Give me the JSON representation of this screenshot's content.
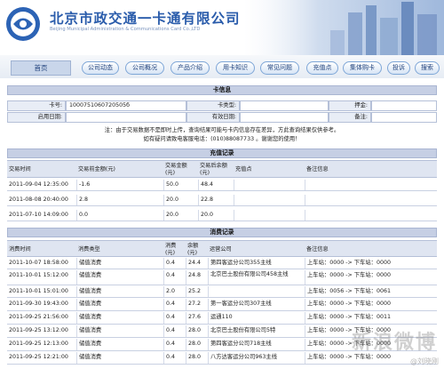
{
  "header": {
    "title_cn": "北京市政交通一卡通有限公司",
    "title_en": "Beijing Municipal Administration & Communications Card Co.,LTD"
  },
  "nav": {
    "home": "首页",
    "items": [
      "公司动态",
      "公司概况",
      "产品介绍",
      "用卡知识",
      "常见问题",
      "充值点",
      "集体购卡",
      "投诉",
      "搜索"
    ]
  },
  "card_info": {
    "title": "卡信息",
    "card_no_label": "卡号:",
    "card_no_value": "1000751060720505б",
    "card_type_label": "卡类型:",
    "card_type_value": "",
    "deposit_label": "押金:",
    "deposit_value": "",
    "enable_date_label": "启用日期:",
    "enable_date_value": "",
    "valid_date_label": "有效日期:",
    "valid_date_value": "",
    "remark_label": "备注:",
    "remark_value": "",
    "note_line1": "注：由于交易数据不是即时上传，查询结果可能与卡内信息存在差异，方此查询结果仅供参考。",
    "note_line2": "如有疑问请致电客服电话：(010)88087733 。谢谢您的使用！"
  },
  "recharge": {
    "title": "充值记录",
    "headers": [
      "交易时间",
      "交易前金额(元)",
      "交易金额(元)",
      "交易后余额(元)",
      "充值点",
      "备注信息"
    ],
    "rows": [
      [
        "2011-09-04 12:35:00",
        "-1.6",
        "50.0",
        "48.4",
        "",
        ""
      ],
      [
        "2011-08-08 20:40:00",
        "2.8",
        "20.0",
        "22.8",
        "",
        ""
      ],
      [
        "2011-07-10 14:09:00",
        "0.0",
        "20.0",
        "20.0",
        "",
        ""
      ]
    ]
  },
  "consume": {
    "title": "消费记录",
    "headers": [
      "消费时间",
      "消费类型",
      "消费(元)",
      "余额(元)",
      "运营公司",
      "备注信息"
    ],
    "rows": [
      [
        "2011-10-07 18:58:00",
        "储值消费",
        "0.4",
        "24.4",
        "第四客运分公司355主线",
        "上车站：0000 -> 下车站：0000"
      ],
      [
        "2011-10-01 15:12:00",
        "储值消费",
        "0.4",
        "24.8",
        "北京巴士股份有限公司458主线",
        "上车站：0000 -> 下车站：0000"
      ],
      [
        "2011-10-01 15:01:00",
        "储值消费",
        "2.0",
        "25.2",
        "",
        "上车站：0056 -> 下车站：0061"
      ],
      [
        "2011-09-30 19:43:00",
        "储值消费",
        "0.4",
        "27.2",
        "第一客运分公司307主线",
        "上车站：0000 -> 下车站：0000"
      ],
      [
        "2011-09-25 21:56:00",
        "储值消费",
        "0.4",
        "27.6",
        "运通110",
        "上车站：0000 -> 下车站：0011"
      ],
      [
        "2011-09-25 13:12:00",
        "储值消费",
        "0.4",
        "28.0",
        "北京巴士股份有限公司5特",
        "上车站：0000 -> 下车站：0000"
      ],
      [
        "2011-09-25 12:13:00",
        "储值消费",
        "0.4",
        "28.0",
        "第四客运分公司718主线",
        "上车站：0000 -> 下车站：0000"
      ],
      [
        "2011-09-25 12:21:00",
        "储值消费",
        "0.4",
        "28.0",
        "八方达客运分公司963主线",
        "上车站：0000 -> 下车站：0000"
      ]
    ]
  },
  "watermark": {
    "main": "新浪微博",
    "sub": "@刘晓刚"
  }
}
